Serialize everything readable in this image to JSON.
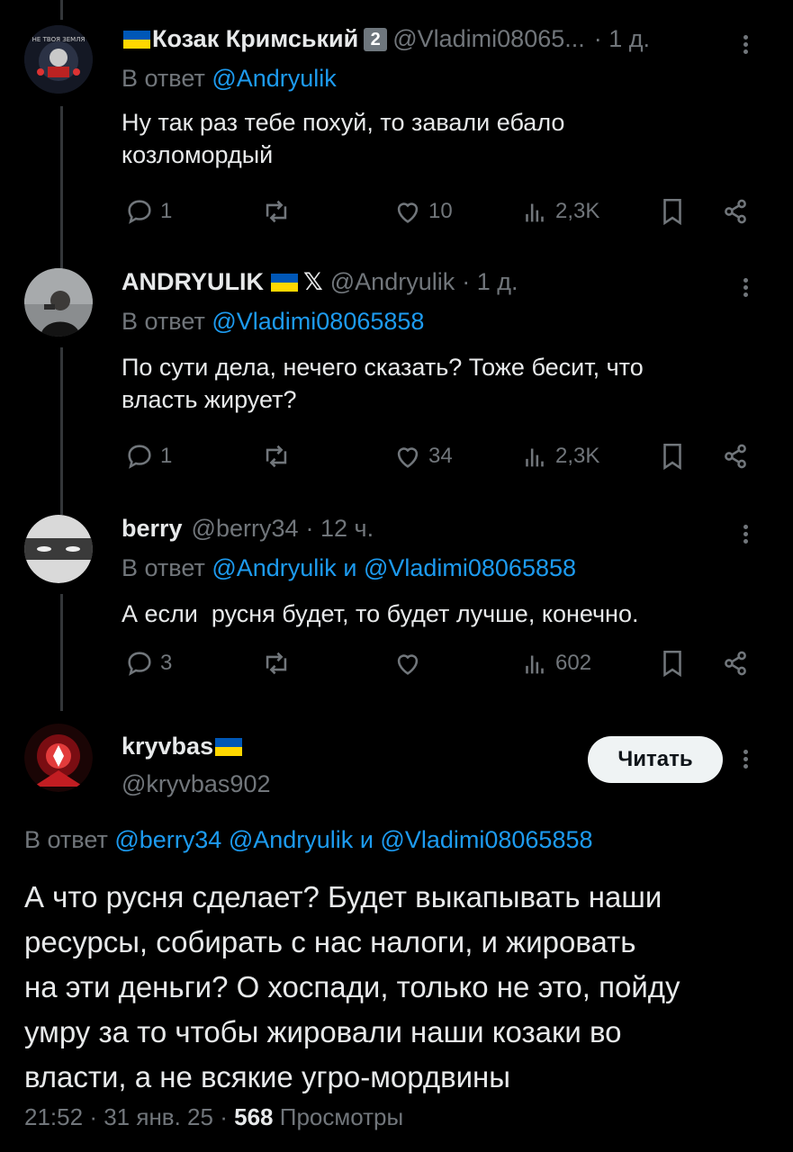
{
  "replies": [
    {
      "name": "Козак Кримський",
      "badge": "2",
      "handle": "@Vladimi08065...",
      "time": "· 1 д.",
      "reply_prefix": "В ответ",
      "reply_to": "@Andryulik",
      "text_lines": [
        "Ну так раз тебе похуй, то завали ебало",
        "козломордый"
      ],
      "replies_count": "1",
      "retweets_count": "",
      "likes_count": "10",
      "views_count": "2,3K"
    },
    {
      "name": "ANDRYULIK",
      "x_mark": "𝕏",
      "handle": "@Andryulik",
      "time": "· 1 д.",
      "reply_prefix": "В ответ",
      "reply_to": "@Vladimi08065858",
      "text_lines": [
        "По сути дела, нечего сказать? Тоже бесит, что",
        "власть жирует?"
      ],
      "replies_count": "1",
      "retweets_count": "",
      "likes_count": "34",
      "views_count": "2,3K"
    },
    {
      "name": "berry",
      "handle": "@berry34",
      "time": "· 12 ч.",
      "reply_prefix": "В ответ",
      "reply_to": "@Andryulik",
      "reply_and": "и",
      "reply_to_2": "@Vladimi08065858",
      "text_lines": [
        "А если  русня будет, то будет лучше, конечно."
      ],
      "replies_count": "3",
      "retweets_count": "",
      "likes_count": "",
      "views_count": "602"
    }
  ],
  "main_post": {
    "name": "kryvbas",
    "handle": "@kryvbas902",
    "follow_label": "Читать",
    "reply_prefix": "В ответ",
    "reply_to_1": "@berry34",
    "reply_to_2": "@Andryulik",
    "reply_and": "и",
    "reply_to_3": "@Vladimi08065858",
    "text_lines": [
      "А что русня сделает? Будет выкапывать наши",
      "ресурсы, собирать с нас налоги, и жировать",
      "на эти деньги? О хоспади, только не это, пойду",
      "умру за то чтобы жировали наши козаки во",
      "власти, а не всякие угро-мордвины"
    ],
    "time": "21:52",
    "date": "31 янв. 25",
    "views_count": "568",
    "views_label": "Просмотры"
  },
  "colors": {
    "background": "#000000",
    "text": "#e7e9ea",
    "muted": "#71767b",
    "link": "#1d9bf0",
    "flag_blue": "#0057b7",
    "flag_yellow": "#ffd700"
  },
  "icons": [
    "reply-icon",
    "retweet-icon",
    "like-icon",
    "views-icon",
    "bookmark-icon",
    "share-icon",
    "more-icon"
  ]
}
